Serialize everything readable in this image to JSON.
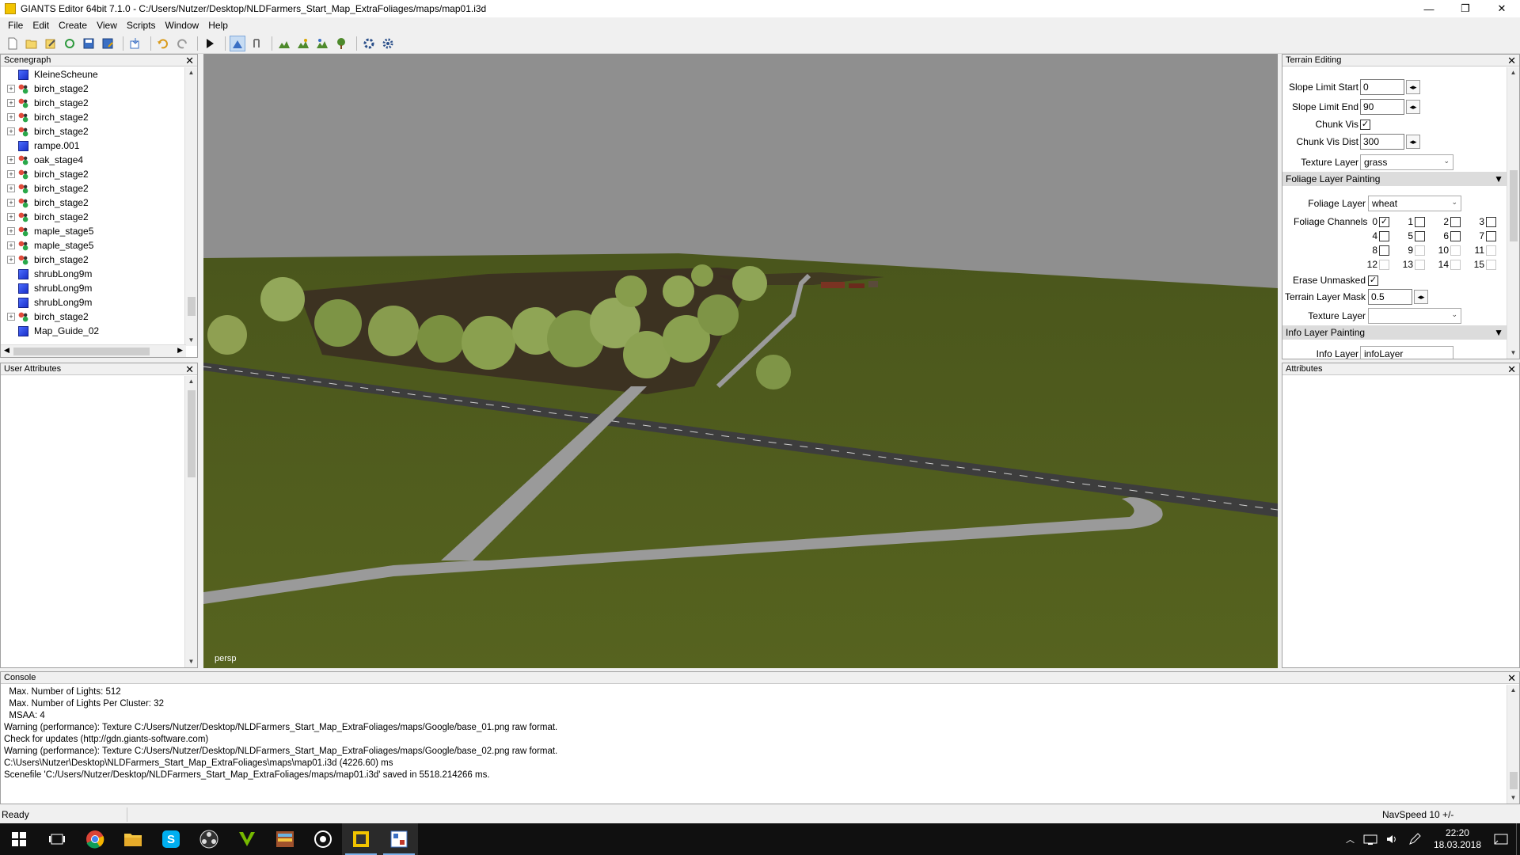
{
  "window": {
    "title": "GIANTS Editor 64bit 7.1.0 - C:/Users/Nutzer/Desktop/NLDFarmers_Start_Map_ExtraFoliages/maps/map01.i3d",
    "minimize": "—",
    "maximize": "❐",
    "close": "✕"
  },
  "menu": [
    "File",
    "Edit",
    "Create",
    "View",
    "Scripts",
    "Window",
    "Help"
  ],
  "toolbar": {
    "icons": [
      "new-file-icon",
      "open-file-icon",
      "edit-file-icon",
      "reload-icon",
      "save-icon",
      "save-as-icon",
      "import-icon",
      "undo-icon",
      "redo-icon",
      "play-icon",
      "select-mode-icon",
      "move-mode-icon",
      "terrain-sculpt-icon",
      "terrain-paint-icon",
      "foliage-paint-icon",
      "tree-paint-icon",
      "settings-icon",
      "scripts-icon"
    ]
  },
  "scenegraph": {
    "title": "Scenegraph",
    "close": "✕",
    "items": [
      {
        "label": "KleineScheune",
        "icon": "cube",
        "expandable": false
      },
      {
        "label": "birch_stage2",
        "icon": "transform-group",
        "expandable": true
      },
      {
        "label": "birch_stage2",
        "icon": "transform-group",
        "expandable": true
      },
      {
        "label": "birch_stage2",
        "icon": "transform-group",
        "expandable": true
      },
      {
        "label": "birch_stage2",
        "icon": "transform-group",
        "expandable": true
      },
      {
        "label": "rampe.001",
        "icon": "cube",
        "expandable": false
      },
      {
        "label": "oak_stage4",
        "icon": "transform-group",
        "expandable": true
      },
      {
        "label": "birch_stage2",
        "icon": "transform-group",
        "expandable": true
      },
      {
        "label": "birch_stage2",
        "icon": "transform-group",
        "expandable": true
      },
      {
        "label": "birch_stage2",
        "icon": "transform-group",
        "expandable": true
      },
      {
        "label": "birch_stage2",
        "icon": "transform-group",
        "expandable": true
      },
      {
        "label": "maple_stage5",
        "icon": "transform-group",
        "expandable": true
      },
      {
        "label": "maple_stage5",
        "icon": "transform-group",
        "expandable": true
      },
      {
        "label": "birch_stage2",
        "icon": "transform-group",
        "expandable": true
      },
      {
        "label": "shrubLong9m",
        "icon": "cube",
        "expandable": false
      },
      {
        "label": "shrubLong9m",
        "icon": "cube",
        "expandable": false
      },
      {
        "label": "shrubLong9m",
        "icon": "cube",
        "expandable": false
      },
      {
        "label": "birch_stage2",
        "icon": "transform-group",
        "expandable": true
      },
      {
        "label": "Map_Guide_02",
        "icon": "cube",
        "expandable": false
      }
    ]
  },
  "user_attributes": {
    "title": "User Attributes",
    "close": "✕"
  },
  "viewport": {
    "camera_label": "persp"
  },
  "terrain_editing": {
    "title": "Terrain Editing",
    "close": "✕",
    "slope_limit_start": {
      "label": "Slope Limit Start",
      "value": "0"
    },
    "slope_limit_end": {
      "label": "Slope Limit End",
      "value": "90"
    },
    "chunk_vis": {
      "label": "Chunk Vis",
      "checked": true
    },
    "chunk_vis_dist": {
      "label": "Chunk Vis Dist",
      "value": "300"
    },
    "texture_layer": {
      "label": "Texture Layer",
      "value": "grass"
    },
    "foliage_section": "Foliage Layer Painting",
    "foliage_layer": {
      "label": "Foliage Layer",
      "value": "wheat"
    },
    "foliage_channels_label": "Foliage Channels",
    "channels": [
      {
        "n": "0",
        "checked": true,
        "enabled": true
      },
      {
        "n": "1",
        "checked": false,
        "enabled": true
      },
      {
        "n": "2",
        "checked": false,
        "enabled": true
      },
      {
        "n": "3",
        "checked": false,
        "enabled": true
      },
      {
        "n": "4",
        "checked": false,
        "enabled": true
      },
      {
        "n": "5",
        "checked": false,
        "enabled": true
      },
      {
        "n": "6",
        "checked": false,
        "enabled": true
      },
      {
        "n": "7",
        "checked": false,
        "enabled": true
      },
      {
        "n": "8",
        "checked": false,
        "enabled": true
      },
      {
        "n": "9",
        "checked": false,
        "enabled": false
      },
      {
        "n": "10",
        "checked": false,
        "enabled": false
      },
      {
        "n": "11",
        "checked": false,
        "enabled": false
      },
      {
        "n": "12",
        "checked": false,
        "enabled": false
      },
      {
        "n": "13",
        "checked": false,
        "enabled": false
      },
      {
        "n": "14",
        "checked": false,
        "enabled": false
      },
      {
        "n": "15",
        "checked": false,
        "enabled": false
      }
    ],
    "erase_unmasked": {
      "label": "Erase Unmasked",
      "checked": true
    },
    "terrain_layer_mask": {
      "label": "Terrain Layer Mask",
      "value": "0.5"
    },
    "texture_layer_2": {
      "label": "Texture Layer",
      "value": ""
    },
    "info_section": "Info Layer Painting",
    "info_layer": {
      "label": "Info Layer",
      "value": "infoLayer"
    },
    "collapse_glyph": "▼",
    "spin_glyph": "◂▸",
    "check_glyph": "✓",
    "caret_glyph": "⌄"
  },
  "attributes": {
    "title": "Attributes",
    "close": "✕"
  },
  "console": {
    "title": "Console",
    "close": "✕",
    "lines": [
      "  Max. Number of Lights: 512",
      "  Max. Number of Lights Per Cluster: 32",
      "  MSAA: 4",
      "Warning (performance): Texture C:/Users/Nutzer/Desktop/NLDFarmers_Start_Map_ExtraFoliages/maps/Google/base_01.png raw format.",
      "Check for updates (http://gdn.giants-software.com)",
      "Warning (performance): Texture C:/Users/Nutzer/Desktop/NLDFarmers_Start_Map_ExtraFoliages/maps/Google/base_02.png raw format.",
      "C:\\Users\\Nutzer\\Desktop\\NLDFarmers_Start_Map_ExtraFoliages\\maps\\map01.i3d (4226.60) ms",
      "Scenefile 'C:/Users/Nutzer/Desktop/NLDFarmers_Start_Map_ExtraFoliages/maps/map01.i3d' saved in 5518.214266 ms."
    ]
  },
  "statusbar": {
    "status": "Ready",
    "navspeed": "NavSpeed 10 +/-"
  },
  "taskbar": {
    "apps": [
      "windows-start-icon",
      "task-view-icon",
      "chrome-icon",
      "file-explorer-icon",
      "skype-icon",
      "obs-icon",
      "nvidia-icon",
      "winrar-icon",
      "steam-icon",
      "giants-editor-icon",
      "paint-icon"
    ],
    "time": "22:20",
    "date": "18.03.2018"
  },
  "colors": {
    "sky": "#8f8f8f",
    "grass": "#4f5c1f",
    "road": "#9a9a9a",
    "asphalt": "#3d3d3d",
    "accent": "#f2c400"
  }
}
